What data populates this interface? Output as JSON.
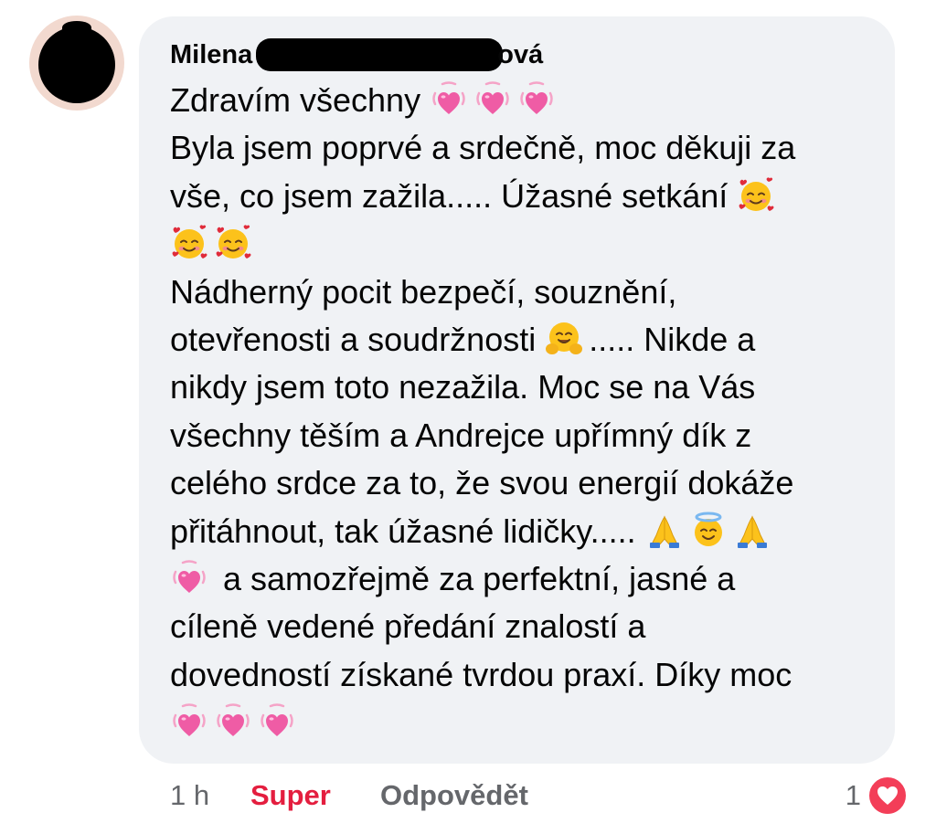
{
  "comment": {
    "author_first": "Milena",
    "author_last_visible": "ová",
    "lines": [
      [
        {
          "t": "Zdravím všechny "
        },
        {
          "e": "growing-heart"
        },
        {
          "e": "growing-heart"
        },
        {
          "e": "growing-heart"
        }
      ],
      [
        {
          "t": "Byla jsem poprvé a srdečně, moc děkuji za"
        }
      ],
      [
        {
          "t": "vše, co jsem zažila..... Úžasné setkání "
        },
        {
          "e": "smiling-face-with-hearts"
        }
      ],
      [
        {
          "e": "smiling-face-with-hearts"
        },
        {
          "e": "smiling-face-with-hearts"
        }
      ],
      [
        {
          "t": "Nádherný pocit bezpečí, souznění,"
        }
      ],
      [
        {
          "t": "otevřenosti a soudržnosti "
        },
        {
          "e": "hugging-face"
        },
        {
          "t": "..... Nikde a"
        }
      ],
      [
        {
          "t": "nikdy jsem toto nezažila. Moc se na Vás"
        }
      ],
      [
        {
          "t": "všechny těším a Andrejce upřímný dík z"
        }
      ],
      [
        {
          "t": "celého srdce za to, že svou energií dokáže"
        }
      ],
      [
        {
          "t": "přitáhnout, tak úžasné lidičky..... "
        },
        {
          "e": "folded-hands"
        },
        {
          "e": "smiling-face-with-halo"
        },
        {
          "e": "folded-hands"
        }
      ],
      [
        {
          "e": "growing-heart"
        },
        {
          "t": " a samozřejmě za perfektní, jasné a"
        }
      ],
      [
        {
          "t": "cíleně vedené předání znalostí a"
        }
      ],
      [
        {
          "t": "dovedností získané tvrdou praxí. Díky moc"
        }
      ],
      [
        {
          "e": "growing-heart"
        },
        {
          "e": "growing-heart"
        },
        {
          "e": "growing-heart"
        }
      ]
    ]
  },
  "footer": {
    "time": "1 h",
    "reaction_label": "Super",
    "reply_label": "Odpovědět",
    "reaction_count": "1",
    "reaction_icon": "love-reaction-icon"
  },
  "colors": {
    "bubble": "#f0f2f5",
    "text": "#050505",
    "muted": "#65676b",
    "reaction_red": "#e41e3f",
    "love_badge": "#f33e58"
  }
}
